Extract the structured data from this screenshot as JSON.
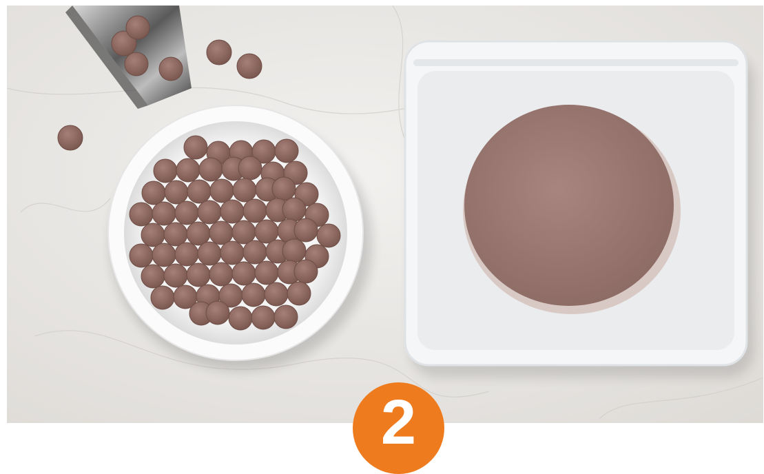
{
  "scene": {
    "subjects": [
      "bowl-of-freeze-dried-nuggets",
      "metal-scoop-with-nuggets",
      "frozen-patty-in-reusable-bag"
    ],
    "surface": "white-marble"
  },
  "step_badge": {
    "number": "2",
    "color": "#ef7b1f"
  },
  "colors": {
    "marble": "#e9e7e4",
    "nugget": "#8e6a60",
    "patty": "#9c7b74",
    "bag": "#eef1f2",
    "bowl": "#fbfbfb"
  }
}
